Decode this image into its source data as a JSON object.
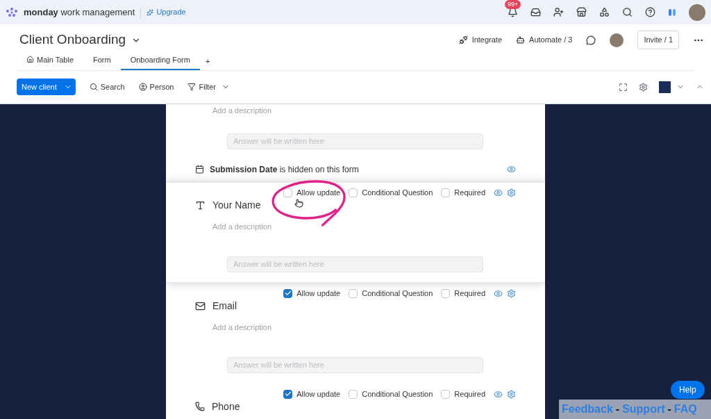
{
  "topbar": {
    "brand_bold": "monday",
    "brand_rest": "work management",
    "upgrade": "Upgrade",
    "notification_badge": "99+"
  },
  "board": {
    "title": "Client Onboarding",
    "integrate": "Integrate",
    "automate": "Automate / 3",
    "invite": "Invite / 1"
  },
  "tabs": [
    {
      "label": "Main Table",
      "selected": false,
      "kind": "home"
    },
    {
      "label": "Form",
      "selected": false,
      "kind": "plain"
    },
    {
      "label": "Onboarding Form",
      "selected": true,
      "kind": "plain"
    }
  ],
  "add_view": "+",
  "toolbar": {
    "new_button": "New client",
    "search": "Search",
    "person": "Person",
    "filter": "Filter"
  },
  "form": {
    "top_fragment": {
      "description": "Add a description",
      "answer_placeholder": "Answer will be written here"
    },
    "hidden_notice": "**Submission Date** is hidden on this form",
    "questions": [
      {
        "title": "Your Name",
        "kind": "text",
        "highlighted": true,
        "description": "Add a description",
        "answer_placeholder": "Answer will be written here",
        "options": [
          {
            "label": "Allow update",
            "checked": false
          },
          {
            "label": "Conditional Question",
            "checked": false
          },
          {
            "label": "Required",
            "checked": false
          }
        ]
      },
      {
        "title": "Email",
        "kind": "email",
        "highlighted": false,
        "description": "Add a description",
        "answer_placeholder": "Answer will be written here",
        "options": [
          {
            "label": "Allow update",
            "checked": true
          },
          {
            "label": "Conditional Question",
            "checked": false
          },
          {
            "label": "Required",
            "checked": false
          }
        ]
      },
      {
        "title": "Phone",
        "kind": "phone",
        "highlighted": false,
        "options": [
          {
            "label": "Allow update",
            "checked": true
          },
          {
            "label": "Conditional Question",
            "checked": false
          },
          {
            "label": "Required",
            "checked": false
          }
        ]
      }
    ]
  },
  "footer_links": [
    {
      "label": "Feedback",
      "kind": "link"
    },
    {
      "label": "-",
      "kind": "separator"
    },
    {
      "label": "Support",
      "kind": "link"
    },
    {
      "label": "-",
      "kind": "separator"
    },
    {
      "label": "FAQ",
      "kind": "link"
    }
  ],
  "help": "Help"
}
